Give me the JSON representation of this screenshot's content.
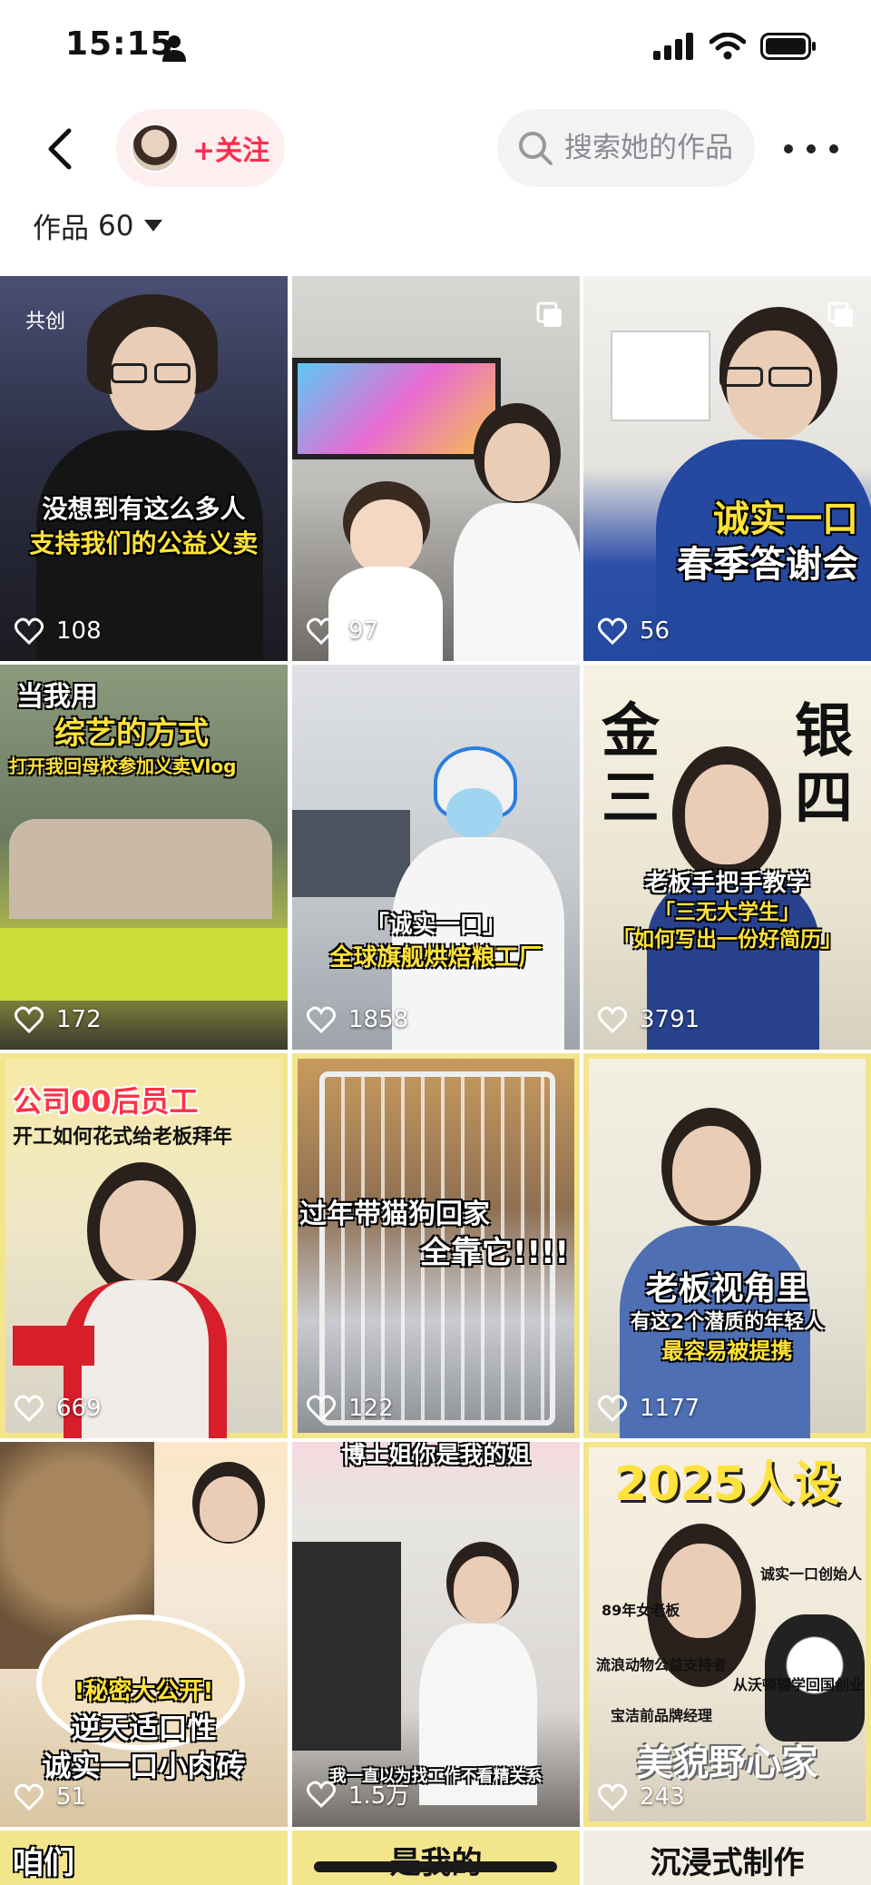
{
  "status_bar": {
    "time": "15:15"
  },
  "nav": {
    "follow_label": "+关注",
    "search_placeholder": "搜索她的作品"
  },
  "works": {
    "label": "作品",
    "count": "60"
  },
  "posts": [
    {
      "caption": [
        "没想到有这么多人",
        "支持我们的公益义卖"
      ],
      "tag": "共创",
      "likes": "108"
    },
    {
      "caption": [],
      "likes": "97"
    },
    {
      "caption": [
        "诚实一口",
        "春季答谢会"
      ],
      "likes": "56"
    },
    {
      "caption": [
        "当我用",
        "综艺的方式",
        "打开我回母校参加义卖Vlog"
      ],
      "likes": "172"
    },
    {
      "caption": [
        "「诚实一口」",
        "全球旗舰烘焙粮工厂"
      ],
      "likes": "1858"
    },
    {
      "caption": [
        "金",
        "银",
        "三",
        "四",
        "老板手把手教学",
        "「三无大学生」",
        "「如何写出一份好简历」"
      ],
      "likes": "3791"
    },
    {
      "caption": [
        "公司00后员工",
        "开工如何花式给老板拜年"
      ],
      "likes": "669"
    },
    {
      "caption": [
        "过年带猫狗回家",
        "全靠它!!!!"
      ],
      "likes": "122"
    },
    {
      "caption": [
        "老板视角里",
        "有这2个潜质的年轻人",
        "最容易被提携"
      ],
      "likes": "1177"
    },
    {
      "caption": [
        "!秘密大公开!",
        "逆天适口性",
        "诚实一口小肉砖"
      ],
      "likes": "51"
    },
    {
      "caption": [
        "博士姐你是我的姐",
        "我一直以为找工作不看精关系"
      ],
      "likes": "1.5万"
    },
    {
      "caption": [
        "2025人设",
        "诚实一口创始人",
        "89年女老板",
        "流浪动物公益支持者",
        "从沃顿辍学回国创业",
        "宝洁前品牌经理",
        "美貌野心家"
      ],
      "likes": "243"
    },
    {
      "caption": [
        "咱们"
      ]
    },
    {
      "caption": [
        "是我的"
      ]
    },
    {
      "caption": [
        "沉浸式制作"
      ]
    }
  ],
  "colors": {
    "accent": "#ff2e4d",
    "caption_yellow": "#ffe23a",
    "caption_white": "#ffffff"
  }
}
